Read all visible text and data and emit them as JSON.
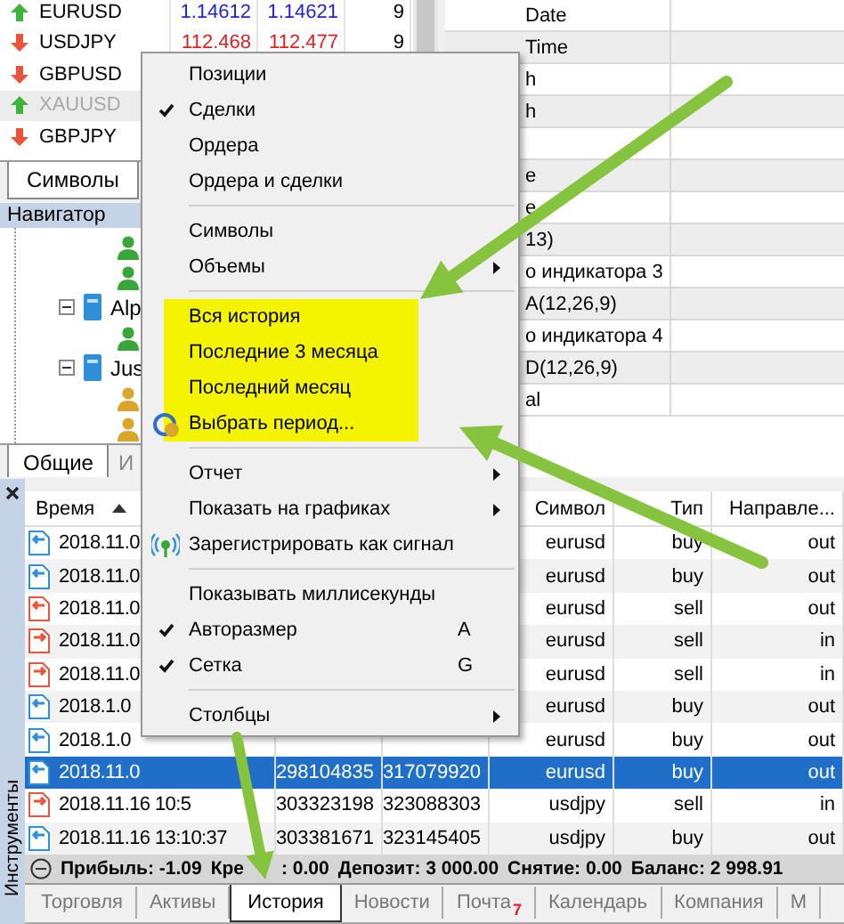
{
  "market_watch": {
    "rows": [
      {
        "kind": "up",
        "symbol": "EURUSD",
        "bid": "1.14612",
        "ask": "1.14621",
        "spread": "9",
        "disabled": false
      },
      {
        "kind": "down",
        "symbol": "USDJPY",
        "bid": "112.468",
        "ask": "112.477",
        "spread": "9",
        "disabled": false
      },
      {
        "kind": "down",
        "symbol": "GBPUSD",
        "disabled": false
      },
      {
        "kind": "up",
        "symbol": "XAUUSD",
        "disabled": true
      },
      {
        "kind": "down",
        "symbol": "GBPJPY",
        "disabled": false
      }
    ],
    "tabs": [
      {
        "label": "Символы",
        "selected": true
      }
    ]
  },
  "data_window": {
    "rows": [
      {
        "label": "Date"
      },
      {
        "label": "Time"
      },
      {
        "label": "h"
      },
      {
        "label": "h"
      },
      {},
      {
        "label": "e"
      },
      {
        "label": "e"
      },
      {
        "label": "13)"
      },
      {
        "label": "о индикатора 3"
      },
      {
        "label": "A(12,26,9)"
      },
      {
        "label": "о индикатора 4"
      },
      {
        "label": "D(12,26,9)"
      },
      {
        "label": "al"
      }
    ]
  },
  "navigator": {
    "title": "Навигатор",
    "tree": [
      {
        "kind": "account",
        "color": "#3aa639"
      },
      {
        "kind": "account",
        "color": "#3aa639"
      },
      {
        "kind": "server",
        "label": "Alp",
        "expanded": true,
        "children": [
          {
            "kind": "account",
            "color": "#3aa639"
          }
        ]
      },
      {
        "kind": "server",
        "label": "Jus",
        "expanded": true,
        "children": [
          {
            "kind": "account",
            "color": "#d9a62b"
          },
          {
            "kind": "account",
            "color": "#d9a62b"
          }
        ]
      }
    ],
    "tabs": [
      {
        "label": "Общие",
        "selected": true
      },
      {
        "label": "И",
        "selected": false
      }
    ]
  },
  "menu": {
    "sections": [
      {
        "highlighted": false,
        "items": [
          {
            "kind": "plain",
            "label": "Позиции",
            "checked": false,
            "submenu": false
          },
          {
            "kind": "plain",
            "label": "Сделки",
            "checked": true,
            "submenu": false
          },
          {
            "kind": "plain",
            "label": "Ордера",
            "checked": false,
            "submenu": false
          },
          {
            "kind": "plain",
            "label": "Ордера и сделки",
            "checked": false,
            "submenu": false
          }
        ]
      },
      {
        "highlighted": false,
        "items": [
          {
            "kind": "plain",
            "label": "Символы",
            "checked": false,
            "submenu": false
          },
          {
            "kind": "plain",
            "label": "Объемы",
            "checked": false,
            "submenu": true
          }
        ]
      },
      {
        "highlighted": true,
        "items": [
          {
            "kind": "plain",
            "label": "Вся история",
            "checked": false,
            "submenu": false
          },
          {
            "kind": "plain",
            "label": "Последние 3 месяца",
            "checked": false,
            "submenu": false
          },
          {
            "kind": "plain",
            "label": "Последний месяц",
            "checked": false,
            "submenu": false
          },
          {
            "kind": "calendar",
            "label": "Выбрать период...",
            "checked": false,
            "submenu": false
          }
        ]
      },
      {
        "highlighted": false,
        "items": [
          {
            "kind": "plain",
            "label": "Отчет",
            "checked": false,
            "submenu": true
          },
          {
            "kind": "plain",
            "label": "Показать на графиках",
            "checked": false,
            "submenu": true
          },
          {
            "kind": "signal",
            "label": "Зарегистрировать как сигнал",
            "checked": false,
            "submenu": false
          }
        ]
      },
      {
        "highlighted": false,
        "items": [
          {
            "kind": "plain",
            "label": "Показывать миллисекунды",
            "checked": false,
            "submenu": false
          },
          {
            "kind": "plain",
            "label": "Авторазмер",
            "checked": true,
            "submenu": false,
            "shortcut": "A"
          },
          {
            "kind": "plain",
            "label": "Сетка",
            "checked": true,
            "submenu": false,
            "shortcut": "G"
          }
        ]
      },
      {
        "highlighted": false,
        "items": [
          {
            "kind": "plain",
            "label": "Столбцы",
            "checked": false,
            "submenu": true
          }
        ]
      }
    ]
  },
  "toolbox": {
    "side_label": "Инструменты",
    "table": {
      "columns": [
        {
          "label": "Время",
          "sorted": true
        },
        {
          "label": "Символ",
          "sorted": false
        },
        {
          "label": "Тип",
          "sorted": false
        },
        {
          "label": "Направле...",
          "sorted": false
        }
      ],
      "rows": [
        {
          "kind": "buy-out",
          "time": "2018.11.0",
          "symbol": "eurusd",
          "type": "buy",
          "direction": "out",
          "selected": false
        },
        {
          "kind": "buy-out",
          "time": "2018.11.0",
          "symbol": "eurusd",
          "type": "buy",
          "direction": "out",
          "selected": false
        },
        {
          "kind": "sell-out",
          "time": "2018.11.0",
          "symbol": "eurusd",
          "type": "sell",
          "direction": "out",
          "selected": false
        },
        {
          "kind": "sell-in",
          "time": "2018.11.0",
          "symbol": "eurusd",
          "type": "sell",
          "direction": "in",
          "selected": false
        },
        {
          "kind": "sell-in",
          "time": "2018.11.0",
          "symbol": "eurusd",
          "type": "sell",
          "direction": "in",
          "selected": false
        },
        {
          "kind": "buy-out",
          "time": "2018.1.0",
          "symbol": "eurusd",
          "type": "buy",
          "direction": "out",
          "selected": false
        },
        {
          "kind": "buy-out",
          "time": "2018.1.0",
          "symbol": "eurusd",
          "type": "buy",
          "direction": "out",
          "selected": false
        },
        {
          "kind": "buy-out",
          "time": "2018.11.0",
          "ticket": "298104835",
          "order": "317079920",
          "symbol": "eurusd",
          "type": "buy",
          "direction": "out",
          "selected": true
        },
        {
          "kind": "sell-in",
          "time": "2018.11.16 10:5",
          "ticket": "303323198",
          "order": "323088303",
          "symbol": "usdjpy",
          "type": "sell",
          "direction": "in",
          "selected": false
        },
        {
          "kind": "buy-out",
          "time": "2018.11.16 13:10:37",
          "ticket": "303381671",
          "order": "323145405",
          "symbol": "usdjpy",
          "type": "buy",
          "direction": "out",
          "selected": false
        }
      ]
    },
    "summary": [
      "Прибыль: -1.09",
      "Кре",
      ": 0.00",
      "Депозит: 3 000.00",
      "Снятие: 0.00",
      "Баланс: 2 998.91"
    ],
    "tabs": [
      {
        "label": "Торговля",
        "selected": false
      },
      {
        "label": "Активы",
        "selected": false
      },
      {
        "label": "История",
        "selected": true
      },
      {
        "label": "Новости",
        "selected": false
      },
      {
        "label": "Почта",
        "selected": false,
        "badge": "7"
      },
      {
        "label": "Календарь",
        "selected": false
      },
      {
        "label": "Компания",
        "selected": false
      },
      {
        "label": "М",
        "selected": false
      }
    ]
  }
}
